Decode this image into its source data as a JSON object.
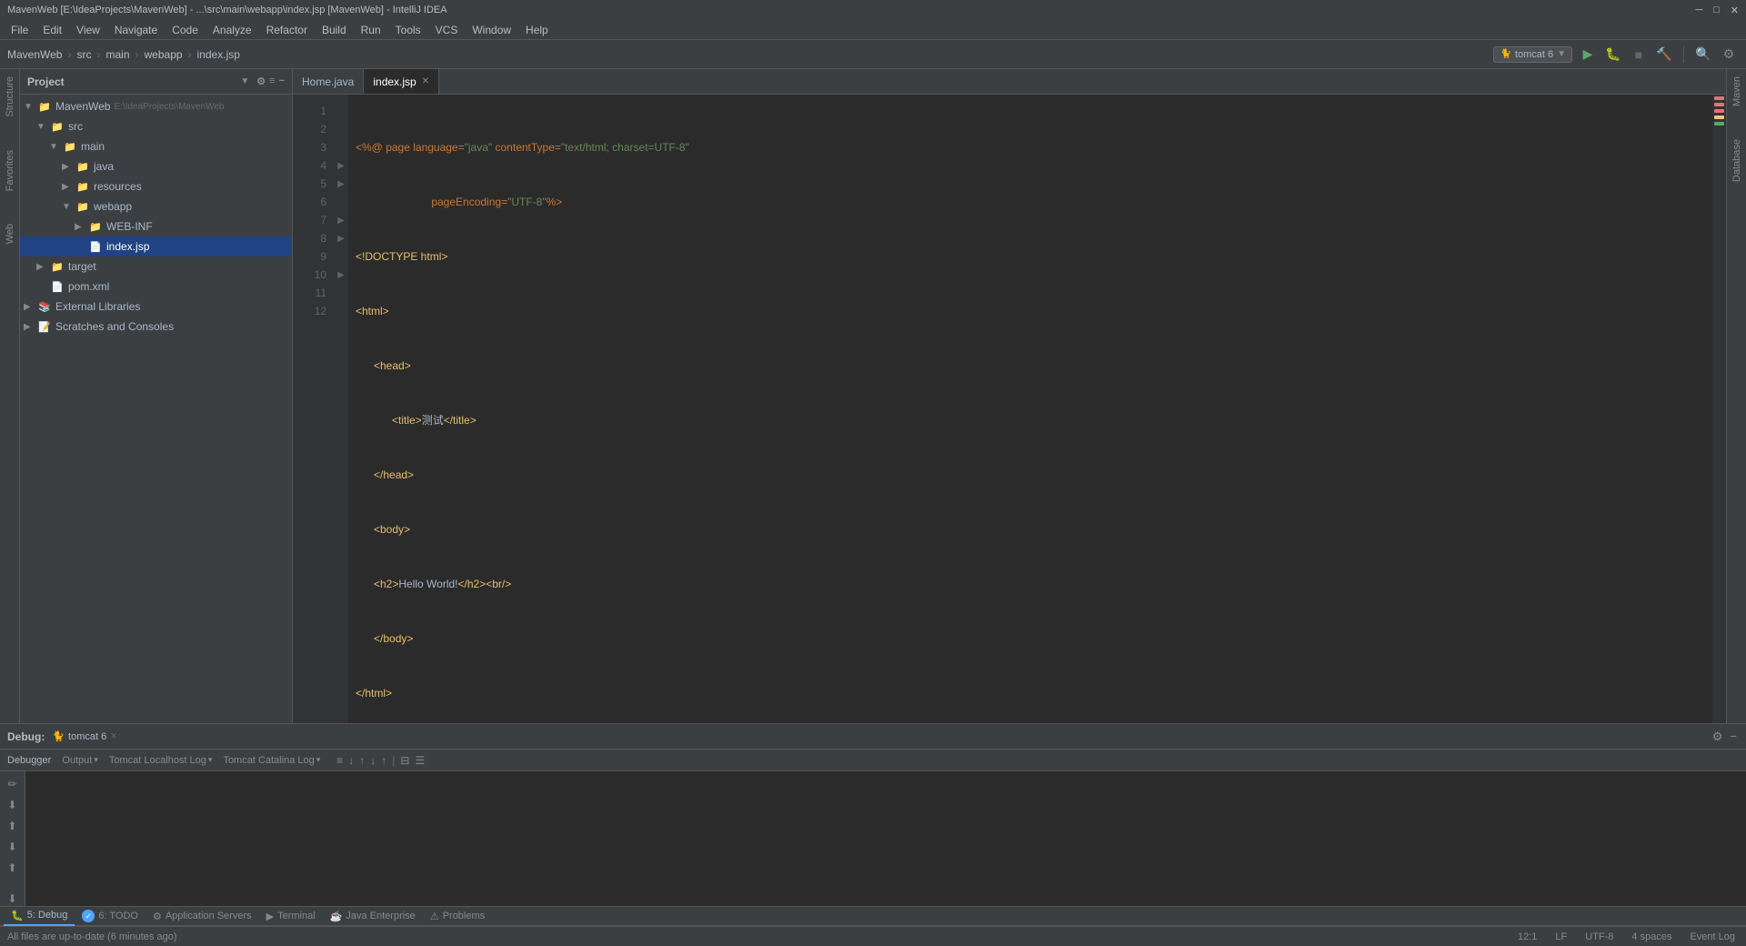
{
  "titleBar": {
    "text": "MavenWeb [E:\\IdeaProjects\\MavenWeb] - ...\\src\\main\\webapp\\index.jsp [MavenWeb] - IntelliJ IDEA"
  },
  "menuBar": {
    "items": [
      "File",
      "Edit",
      "View",
      "Navigate",
      "Code",
      "Analyze",
      "Refactor",
      "Build",
      "Run",
      "Tools",
      "VCS",
      "Window",
      "Help"
    ]
  },
  "toolbar": {
    "breadcrumb": [
      "MavenWeb",
      "src",
      "main",
      "webapp",
      "index.jsp"
    ],
    "runConfig": "tomcat 6",
    "buttons": {
      "run": "▶",
      "debug": "🐛",
      "stop": "■",
      "build": "🔨"
    }
  },
  "projectPanel": {
    "title": "Project",
    "tree": [
      {
        "label": "MavenWeb",
        "path": "E:\\IdeaProjects\\MavenWeb",
        "level": 0,
        "type": "project",
        "expanded": true
      },
      {
        "label": "src",
        "level": 1,
        "type": "folder",
        "expanded": true
      },
      {
        "label": "main",
        "level": 2,
        "type": "folder",
        "expanded": true
      },
      {
        "label": "java",
        "level": 3,
        "type": "folder",
        "expanded": false
      },
      {
        "label": "resources",
        "level": 3,
        "type": "folder",
        "expanded": false
      },
      {
        "label": "webapp",
        "level": 3,
        "type": "folder",
        "expanded": true
      },
      {
        "label": "WEB-INF",
        "level": 4,
        "type": "folder",
        "expanded": false
      },
      {
        "label": "index.jsp",
        "level": 4,
        "type": "jsp",
        "expanded": false,
        "selected": true
      },
      {
        "label": "target",
        "level": 1,
        "type": "folder",
        "expanded": false
      },
      {
        "label": "pom.xml",
        "level": 1,
        "type": "xml",
        "expanded": false
      },
      {
        "label": "External Libraries",
        "level": 0,
        "type": "folder",
        "expanded": false
      },
      {
        "label": "Scratches and Consoles",
        "level": 0,
        "type": "folder",
        "expanded": false
      }
    ]
  },
  "editor": {
    "tabs": [
      {
        "label": "Home.java",
        "active": false
      },
      {
        "label": "index.jsp",
        "active": true
      }
    ],
    "lines": [
      {
        "num": 1,
        "content": "<%@ page language=\"java\" contentType=\"text/html; charset=UTF-8\""
      },
      {
        "num": 2,
        "content": "         pageEncoding=\"UTF-8\"%>"
      },
      {
        "num": 3,
        "content": "<!DOCTYPE html>"
      },
      {
        "num": 4,
        "content": "<html>"
      },
      {
        "num": 5,
        "content": "    <head>"
      },
      {
        "num": 6,
        "content": "        <title>测试</title>"
      },
      {
        "num": 7,
        "content": "    </head>"
      },
      {
        "num": 8,
        "content": "    <body>"
      },
      {
        "num": 9,
        "content": "    <h2>Hello World!</h2><br/>"
      },
      {
        "num": 10,
        "content": "    </body>"
      },
      {
        "num": 11,
        "content": "</html>"
      },
      {
        "num": 12,
        "content": ""
      }
    ]
  },
  "debugPanel": {
    "label": "Debug:",
    "activeTab": "tomcat 6",
    "tabs": [
      "Debugger",
      "Output",
      "Tomcat Localhost Log",
      "Tomcat Catalina Log"
    ],
    "buttons": [
      "pencil",
      "step-down",
      "step-up",
      "step-in",
      "step-out",
      "pause",
      "stop",
      "rerun"
    ]
  },
  "bottomTabs": [
    {
      "label": "5: Debug",
      "icon": "🐛",
      "active": true
    },
    {
      "label": "6: TODO",
      "icon": "✓"
    },
    {
      "label": "Application Servers",
      "icon": "⚙"
    },
    {
      "label": "Terminal",
      "icon": ">"
    },
    {
      "label": "Java Enterprise",
      "icon": "☕"
    },
    {
      "label": "Problems",
      "icon": "⚠"
    }
  ],
  "statusBar": {
    "message": "All files are up-to-date (6 minutes ago)",
    "position": "12:1",
    "lineEnding": "LF",
    "encoding": "UTF-8",
    "indent": "4 spaces",
    "eventLog": "Event Log"
  }
}
